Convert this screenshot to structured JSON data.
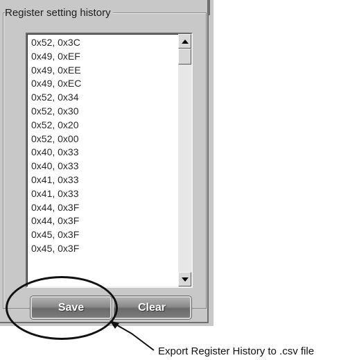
{
  "group_title": "Register setting history",
  "history": [
    "0x52, 0x3C",
    "0x49, 0xEF",
    "0x49, 0xEE",
    "0x49, 0xEC",
    "0x52, 0x34",
    "0x52, 0x30",
    "0x52, 0x20",
    "0x52, 0x00",
    "0x40, 0x33",
    "0x40, 0x33",
    "0x41, 0x33",
    "0x41, 0x33",
    "0x44, 0x3F",
    "0x44, 0x3F",
    "0x45, 0x3F",
    "0x45, 0x3F"
  ],
  "buttons": {
    "save_label": "Save",
    "clear_label": "Clear"
  },
  "annotation": "Export Register History to .csv file",
  "icons": {
    "scroll_up": "arrow-up-icon",
    "scroll_down": "arrow-down-icon"
  }
}
